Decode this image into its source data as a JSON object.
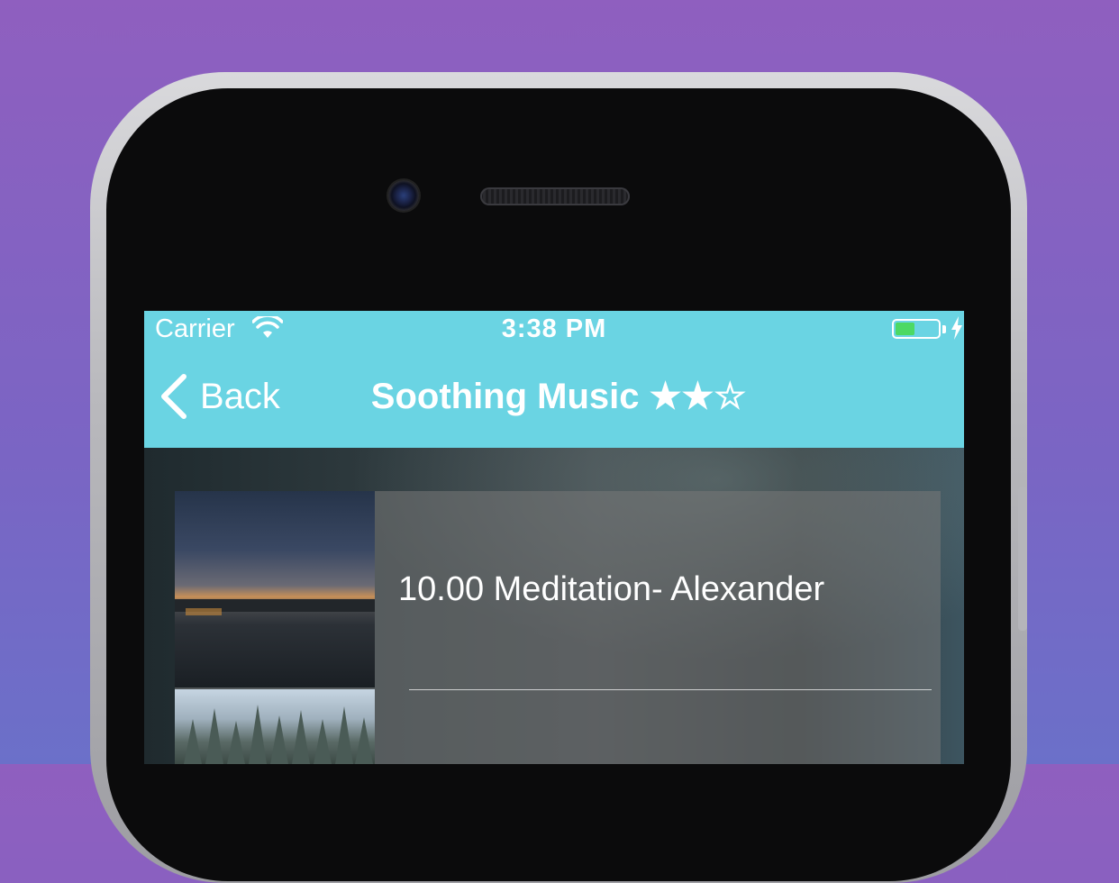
{
  "status_bar": {
    "carrier": "Carrier",
    "time": "3:38 PM",
    "battery_level": 0.45,
    "battery_color": "#4cd964",
    "wifi_icon": "wifi-icon",
    "charging_icon": "bolt-icon"
  },
  "nav_bar": {
    "back_label": "Back",
    "back_icon": "chevron-left-icon",
    "title": "Soothing Music ★★☆",
    "background_color": "#6ad4e3"
  },
  "tracks": [
    {
      "title": "10.00 Meditation- Alexander",
      "thumbnail": "sunset-over-water"
    },
    {
      "title": "",
      "thumbnail": "misty-trees"
    }
  ],
  "colors": {
    "page_background": "#8f5fbf",
    "accent": "#6ad4e3"
  }
}
